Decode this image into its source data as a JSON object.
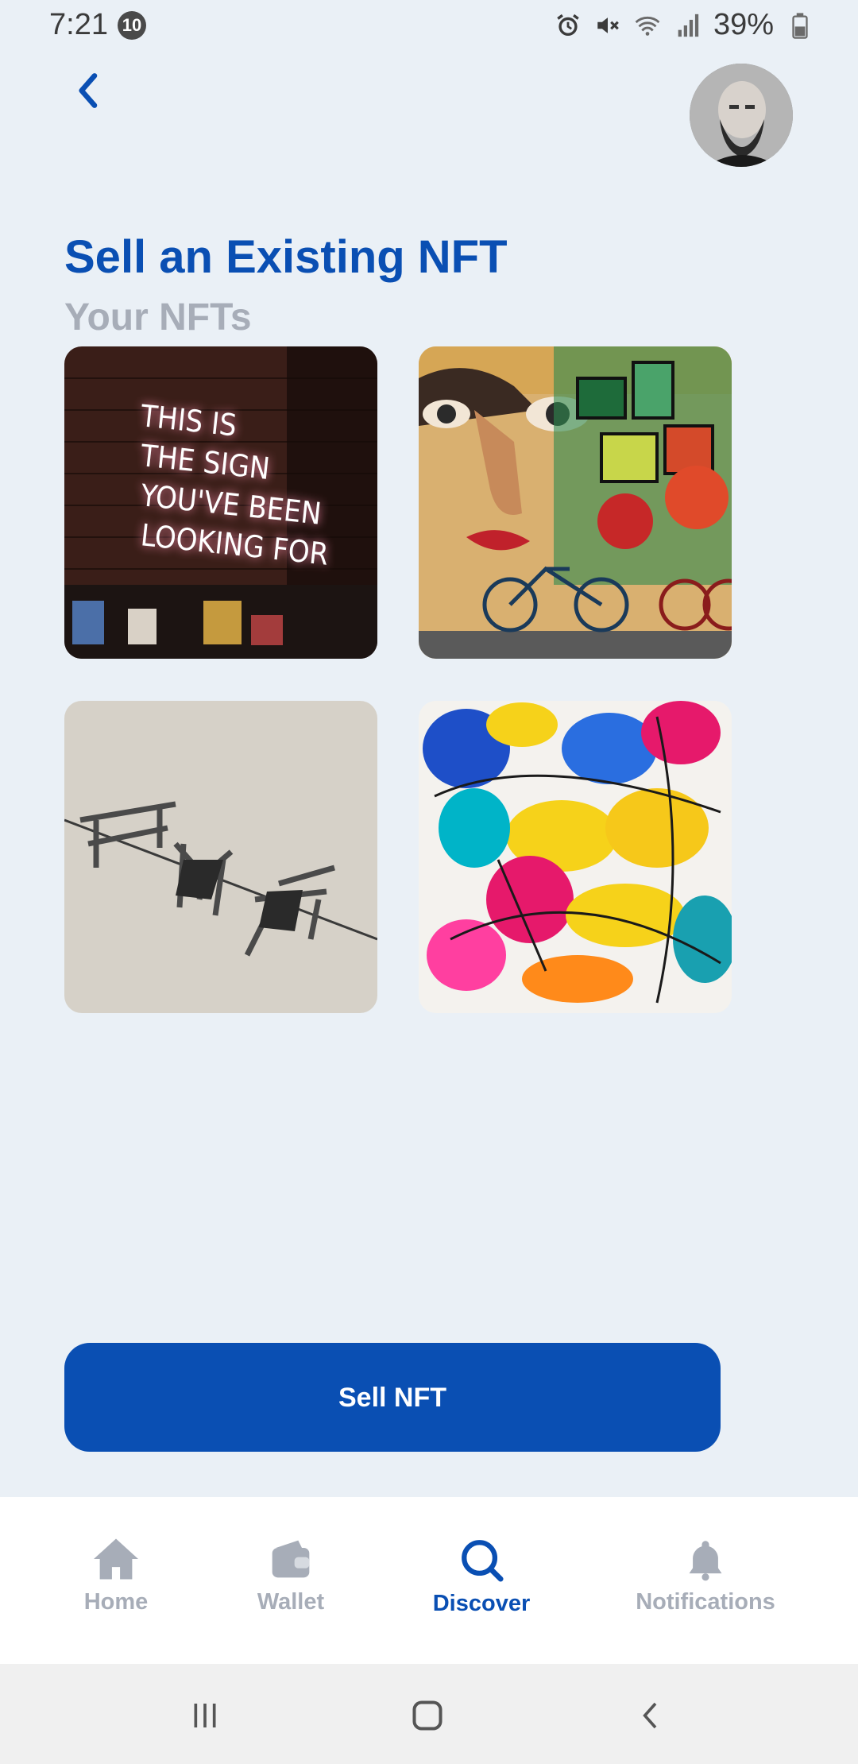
{
  "status_bar": {
    "time": "7:21",
    "notification_count": "10",
    "battery": "39%",
    "icons": [
      "alarm-icon",
      "mute-icon",
      "wifi-icon",
      "signal-icon",
      "battery-icon"
    ]
  },
  "header": {
    "back_icon": "chevron-left-icon",
    "avatar": "profile-avatar"
  },
  "page": {
    "title": "Sell an Existing NFT",
    "subtitle": "Your NFTs"
  },
  "nfts": [
    {
      "name": "neon-sign-nft",
      "neon_lines": [
        "THIS IS",
        "THE SIGN",
        "YOU'VE BEEN",
        "LOOKING FOR"
      ]
    },
    {
      "name": "street-mural-nft"
    },
    {
      "name": "floating-chairs-nft"
    },
    {
      "name": "abstract-paint-nft"
    }
  ],
  "actions": {
    "sell_label": "Sell NFT"
  },
  "bottom_nav": {
    "items": [
      {
        "label": "Home",
        "icon": "home-icon",
        "active": false
      },
      {
        "label": "Wallet",
        "icon": "wallet-icon",
        "active": false
      },
      {
        "label": "Discover",
        "icon": "search-icon",
        "active": true
      },
      {
        "label": "Notifications",
        "icon": "bell-icon",
        "active": false
      }
    ]
  },
  "colors": {
    "accent": "#0a4fb3",
    "inactive": "#a7adb8",
    "background": "#eaf0f6"
  }
}
